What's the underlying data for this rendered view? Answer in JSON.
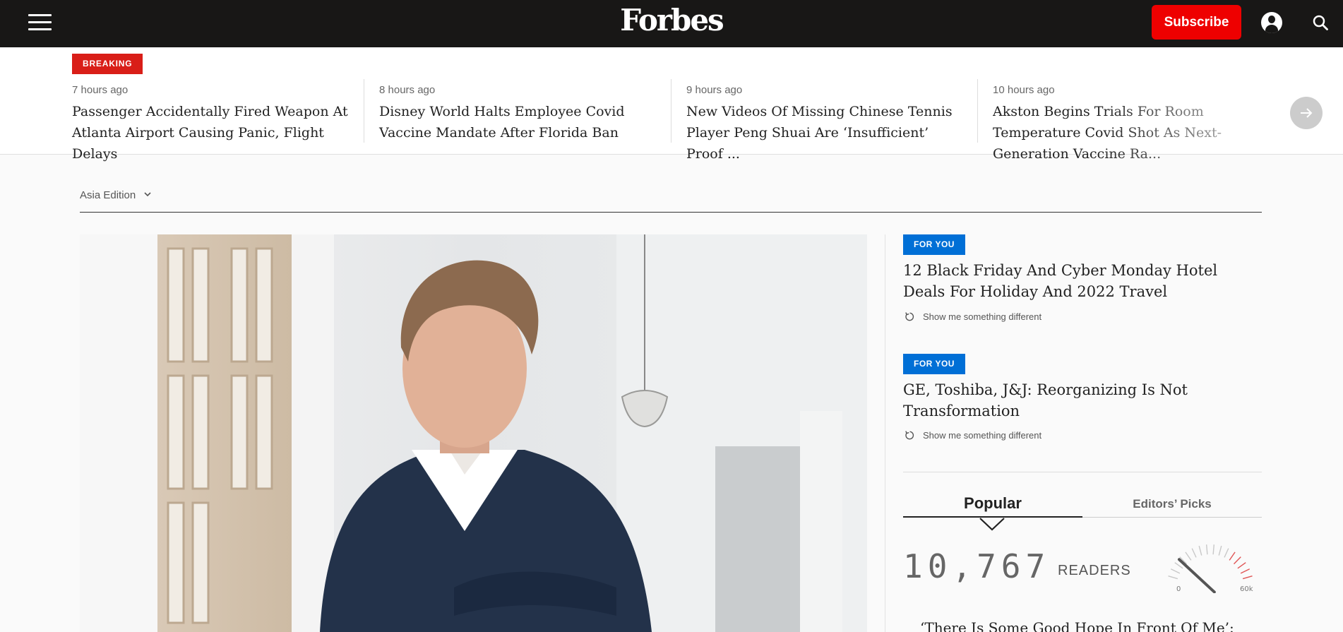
{
  "nav": {
    "logo": "Forbes",
    "subscribe_label": "Subscribe"
  },
  "ticker": {
    "badge": "BREAKING",
    "items": [
      {
        "time": "7 hours ago",
        "title": "Passenger Accidentally Fired Weapon At Atlanta Airport Causing Panic, Flight Delays"
      },
      {
        "time": "8 hours ago",
        "title": "Disney World Halts Employee Covid Vaccine Mandate After Florida Ban"
      },
      {
        "time": "9 hours ago",
        "title": "New Videos Of Missing Chinese Tennis Player Peng Shuai Are ‘Insufficient’ Proof ..."
      },
      {
        "time": "10 hours ago",
        "title": "Akston Begins Trials For Room Temperature Covid Shot As Next-Generation Vaccine Ra..."
      }
    ]
  },
  "edition": {
    "label": "Asia Edition"
  },
  "for_you": [
    {
      "badge": "FOR YOU",
      "title": "12 Black Friday And Cyber Monday Hotel Deals For Holiday And 2022 Travel",
      "refresh": "Show me something different"
    },
    {
      "badge": "FOR YOU",
      "title": "GE, Toshiba, J&J: Reorganizing Is Not Transformation",
      "refresh": "Show me something different"
    }
  ],
  "tabs": {
    "popular": "Popular",
    "editors": "Editors’ Picks"
  },
  "readers": {
    "count": "10,767",
    "label": "READERS",
    "gauge_min": "0",
    "gauge_max": "60k",
    "gauge_fraction": 0.18
  },
  "popular_first": "‘There Is Some Good Hope In Front Of Me’:",
  "icons": {
    "menu": "hamburger-menu-icon",
    "user": "user-icon",
    "search": "search-icon",
    "next": "arrow-right-icon",
    "refresh": "refresh-icon",
    "edition": "chevron-down-icon"
  },
  "colors": {
    "nav_bg": "#181716",
    "subscribe": "#ee0000",
    "breaking": "#d91e18",
    "for_you": "#006fd6"
  }
}
